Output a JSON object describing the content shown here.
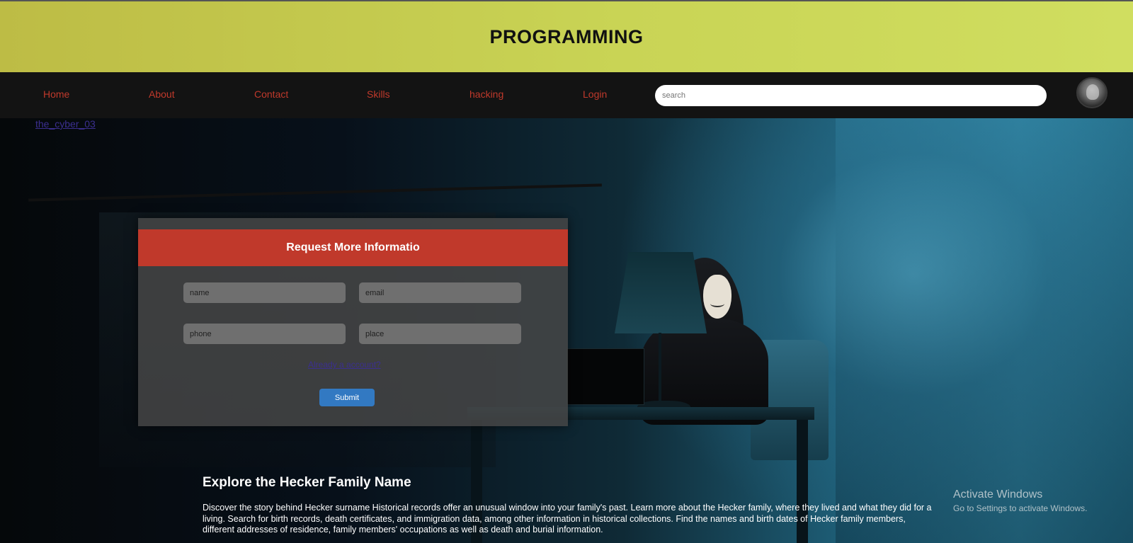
{
  "header": {
    "title": "PROGRAMMING"
  },
  "nav": {
    "items": [
      "Home",
      "About",
      "Contact",
      "Skills",
      "hacking",
      "Login"
    ],
    "search_placeholder": "search"
  },
  "tagline": "the_cyber_03",
  "form": {
    "title": "Request More Informatio",
    "fields": {
      "name": "name",
      "email": "email",
      "phone": "phone",
      "place": "place"
    },
    "link_text": "Already a account?",
    "submit_label": "Submit"
  },
  "content": {
    "title": "Explore the Hecker Family Name",
    "body": "Discover the story behind Hecker surname Historical records offer an unusual window into your family's past. Learn more about the Hecker family, where they lived and what they did for a living. Search for birth records, death certificates, and immigration data, among other information in historical collections. Find the names and birth dates of Hecker family members, different addresses of residence, family members' occupations as well as death and burial information."
  },
  "activate_windows": {
    "title": "Activate Windows",
    "subtitle": "Go to Settings to activate Windows."
  },
  "colors": {
    "header_bg": "#c9d455",
    "nav_bg": "#131313",
    "nav_link": "#c0392b",
    "form_header": "#c0392b",
    "submit": "#3279c2"
  }
}
